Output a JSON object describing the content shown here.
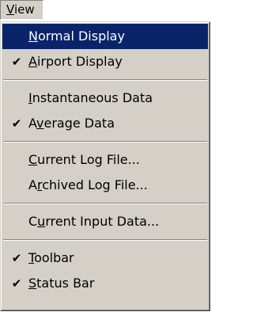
{
  "menubar": {
    "label_pre": "",
    "label_key": "V",
    "label_post": "iew"
  },
  "menu": {
    "items": [
      {
        "pre": "",
        "key": "N",
        "post": "ormal Display",
        "checked": false,
        "highlighted": true
      },
      {
        "pre": "",
        "key": "A",
        "post": "irport Display",
        "checked": true,
        "highlighted": false
      },
      {
        "pre": "",
        "key": "I",
        "post": "nstantaneous Data",
        "checked": false,
        "highlighted": false
      },
      {
        "pre": "A",
        "key": "v",
        "post": "erage Data",
        "checked": true,
        "highlighted": false
      },
      {
        "pre": "",
        "key": "C",
        "post": "urrent Log File...",
        "checked": false,
        "highlighted": false
      },
      {
        "pre": "A",
        "key": "r",
        "post": "chived Log File...",
        "checked": false,
        "highlighted": false
      },
      {
        "pre": "C",
        "key": "u",
        "post": "rrent Input Data...",
        "checked": false,
        "highlighted": false
      },
      {
        "pre": "",
        "key": "T",
        "post": "oolbar",
        "checked": true,
        "highlighted": false
      },
      {
        "pre": "",
        "key": "S",
        "post": "tatus Bar",
        "checked": true,
        "highlighted": false
      }
    ]
  },
  "check_glyph": "✔",
  "colors": {
    "menu_bg": "#d4d0c8",
    "highlight_bg": "#0a246a",
    "highlight_fg": "#ffffff"
  }
}
